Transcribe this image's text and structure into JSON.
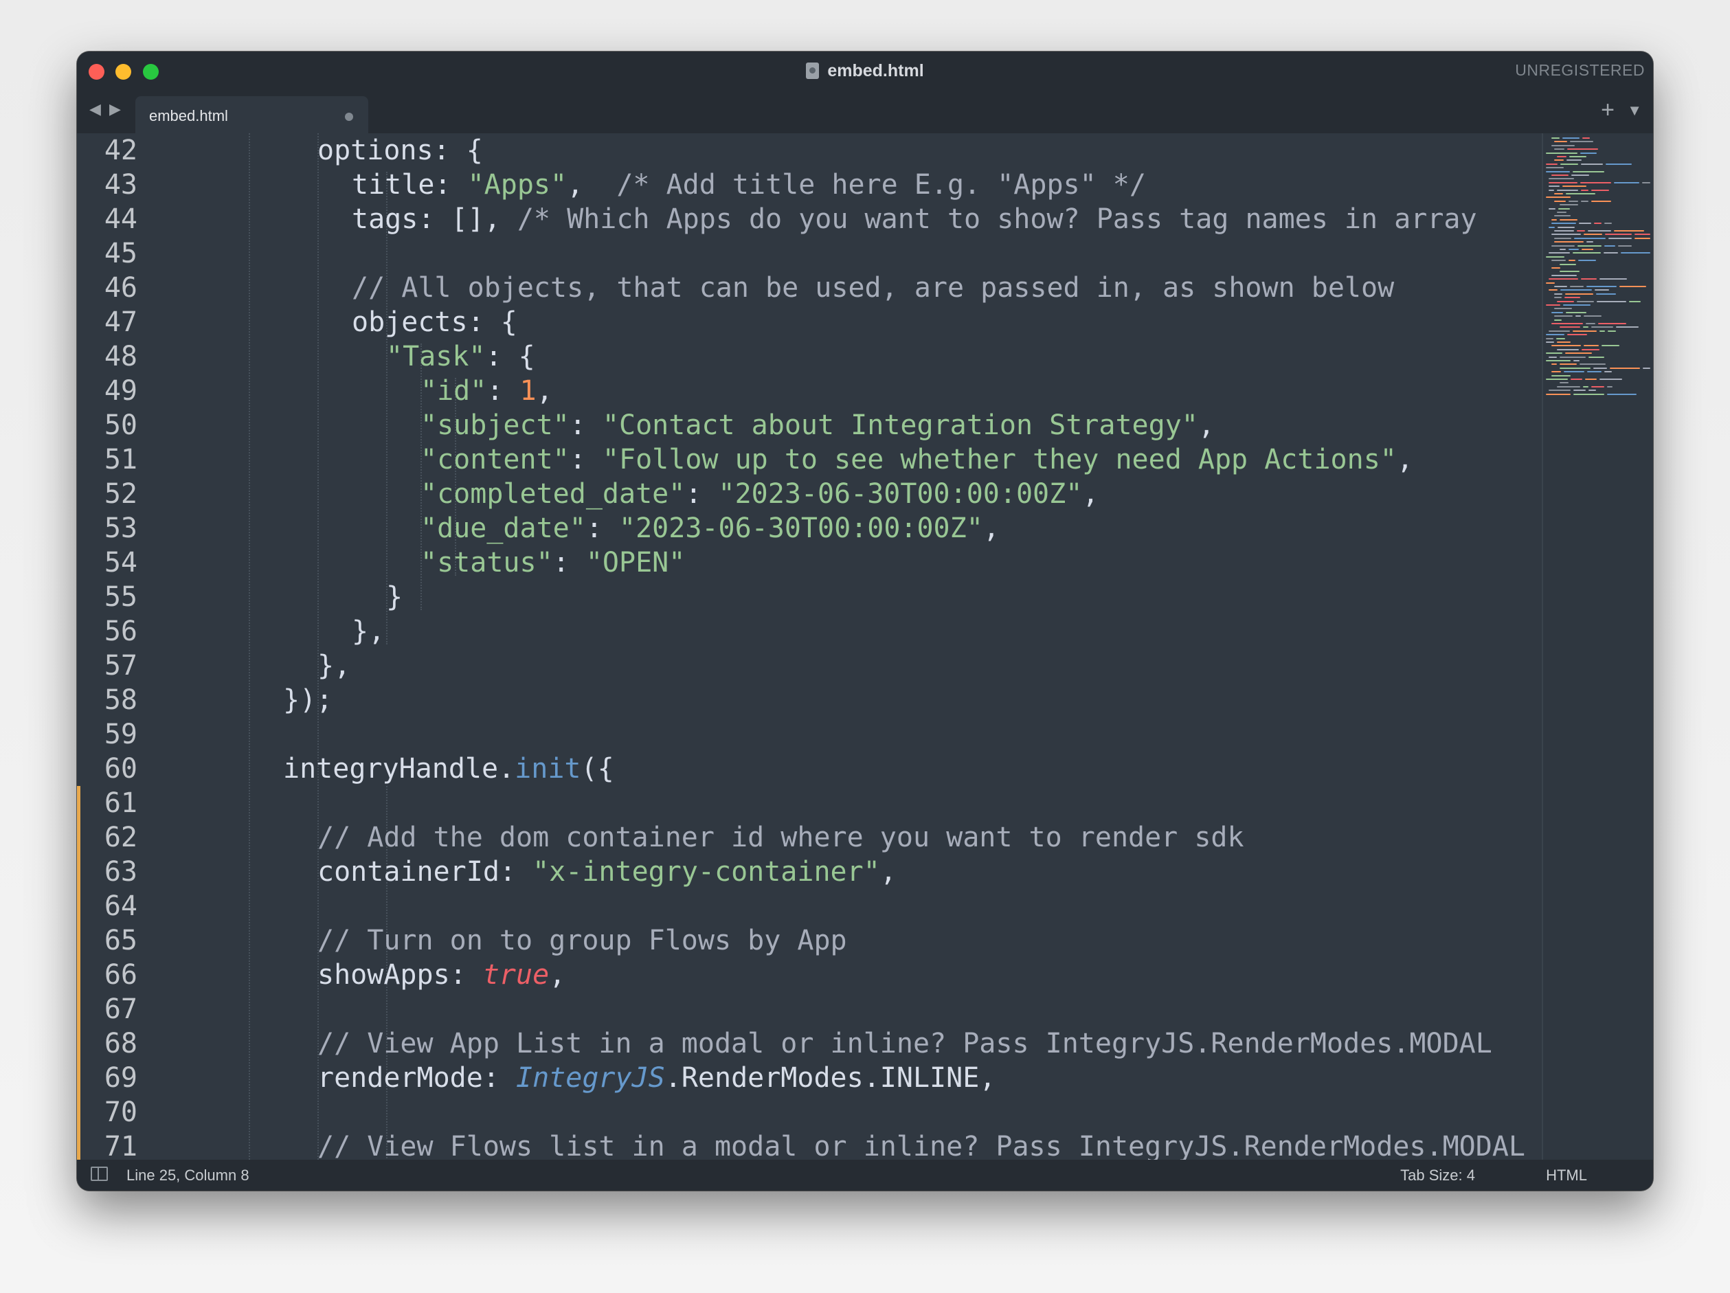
{
  "window": {
    "title": "embed.html",
    "registration": "UNREGISTERED"
  },
  "tabs": [
    {
      "label": "embed.html",
      "unsaved": true
    }
  ],
  "statusbar": {
    "position": "Line 25, Column 8",
    "tab_size": "Tab Size: 4",
    "syntax": "HTML"
  },
  "colors": {
    "background": "#303841",
    "string": "#99c794",
    "number": "#f99157",
    "keyword_bool": "#ec5f66",
    "function": "#6699cc",
    "comment": "#a7adba",
    "modified_marker": "#e8a94e"
  },
  "editor": {
    "modified_lines": [
      61,
      62,
      63,
      64,
      65,
      66,
      67,
      68,
      69,
      70,
      71
    ],
    "lines": [
      {
        "n": "42",
        "indent": 4,
        "tokens": [
          [
            "plain",
            "options: {"
          ]
        ]
      },
      {
        "n": "43",
        "indent": 5,
        "tokens": [
          [
            "plain",
            "title: "
          ],
          [
            "string",
            "\"Apps\""
          ],
          [
            "plain",
            ",  "
          ],
          [
            "comment",
            "/* Add title here E.g. \"Apps\" */"
          ]
        ]
      },
      {
        "n": "44",
        "indent": 5,
        "tokens": [
          [
            "plain",
            "tags: [], "
          ],
          [
            "comment",
            "/* Which Apps do you want to show? Pass tag names in array"
          ]
        ]
      },
      {
        "n": "45",
        "indent": 0,
        "tokens": []
      },
      {
        "n": "46",
        "indent": 5,
        "tokens": [
          [
            "comment",
            "// All objects, that can be used, are passed in, as shown below"
          ]
        ]
      },
      {
        "n": "47",
        "indent": 5,
        "tokens": [
          [
            "plain",
            "objects: {"
          ]
        ]
      },
      {
        "n": "48",
        "indent": 6,
        "tokens": [
          [
            "string",
            "\"Task\""
          ],
          [
            "plain",
            ": {"
          ]
        ]
      },
      {
        "n": "49",
        "indent": 7,
        "tokens": [
          [
            "string",
            "\"id\""
          ],
          [
            "plain",
            ": "
          ],
          [
            "number",
            "1"
          ],
          [
            "plain",
            ","
          ]
        ]
      },
      {
        "n": "50",
        "indent": 7,
        "tokens": [
          [
            "string",
            "\"subject\""
          ],
          [
            "plain",
            ": "
          ],
          [
            "string",
            "\"Contact about Integration Strategy\""
          ],
          [
            "plain",
            ","
          ]
        ]
      },
      {
        "n": "51",
        "indent": 7,
        "tokens": [
          [
            "string",
            "\"content\""
          ],
          [
            "plain",
            ": "
          ],
          [
            "string",
            "\"Follow up to see whether they need App Actions\""
          ],
          [
            "plain",
            ","
          ]
        ]
      },
      {
        "n": "52",
        "indent": 7,
        "tokens": [
          [
            "string",
            "\"completed_date\""
          ],
          [
            "plain",
            ": "
          ],
          [
            "string",
            "\"2023-06-30T00:00:00Z\""
          ],
          [
            "plain",
            ","
          ]
        ]
      },
      {
        "n": "53",
        "indent": 7,
        "tokens": [
          [
            "string",
            "\"due_date\""
          ],
          [
            "plain",
            ": "
          ],
          [
            "string",
            "\"2023-06-30T00:00:00Z\""
          ],
          [
            "plain",
            ","
          ]
        ]
      },
      {
        "n": "54",
        "indent": 7,
        "tokens": [
          [
            "string",
            "\"status\""
          ],
          [
            "plain",
            ": "
          ],
          [
            "string",
            "\"OPEN\""
          ]
        ]
      },
      {
        "n": "55",
        "indent": 6,
        "tokens": [
          [
            "plain",
            "}"
          ]
        ]
      },
      {
        "n": "56",
        "indent": 5,
        "tokens": [
          [
            "plain",
            "},"
          ]
        ]
      },
      {
        "n": "57",
        "indent": 4,
        "tokens": [
          [
            "plain",
            "},"
          ]
        ]
      },
      {
        "n": "58",
        "indent": 3,
        "tokens": [
          [
            "plain",
            "});"
          ]
        ]
      },
      {
        "n": "59",
        "indent": 0,
        "tokens": []
      },
      {
        "n": "60",
        "indent": 3,
        "tokens": [
          [
            "plain",
            "integryHandle."
          ],
          [
            "func",
            "init"
          ],
          [
            "plain",
            "({"
          ]
        ]
      },
      {
        "n": "61",
        "indent": 0,
        "tokens": []
      },
      {
        "n": "62",
        "indent": 4,
        "tokens": [
          [
            "comment",
            "// Add the dom container id where you want to render sdk"
          ]
        ]
      },
      {
        "n": "63",
        "indent": 4,
        "tokens": [
          [
            "plain",
            "containerId: "
          ],
          [
            "string",
            "\"x-integry-container\""
          ],
          [
            "plain",
            ","
          ]
        ]
      },
      {
        "n": "64",
        "indent": 0,
        "tokens": []
      },
      {
        "n": "65",
        "indent": 4,
        "tokens": [
          [
            "comment",
            "// Turn on to group Flows by App"
          ]
        ]
      },
      {
        "n": "66",
        "indent": 4,
        "tokens": [
          [
            "plain",
            "showApps: "
          ],
          [
            "bool",
            "true"
          ],
          [
            "plain",
            ","
          ]
        ]
      },
      {
        "n": "67",
        "indent": 0,
        "tokens": []
      },
      {
        "n": "68",
        "indent": 4,
        "tokens": [
          [
            "comment",
            "// View App List in a modal or inline? Pass IntegryJS.RenderModes.MODAL"
          ]
        ]
      },
      {
        "n": "69",
        "indent": 4,
        "tokens": [
          [
            "plain",
            "renderMode: "
          ],
          [
            "class",
            "IntegryJS"
          ],
          [
            "plain",
            ".RenderModes.INLINE,"
          ]
        ]
      },
      {
        "n": "70",
        "indent": 0,
        "tokens": []
      },
      {
        "n": "71",
        "indent": 4,
        "tokens": [
          [
            "comment",
            "// View Flows list in a modal or inline? Pass IntegryJS.RenderModes.MODAL"
          ]
        ]
      }
    ]
  }
}
